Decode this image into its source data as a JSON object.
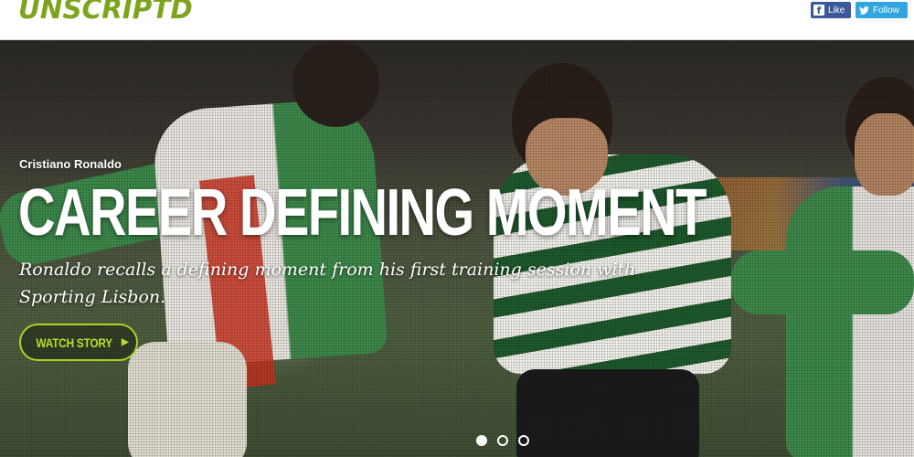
{
  "header": {
    "logo": "UNSCRIPTD",
    "social": {
      "facebook_label": "Like",
      "facebook_icon": "f",
      "twitter_label": "Follow",
      "twitter_icon": "🐦"
    }
  },
  "hero": {
    "subtitle": "Cristiano Ronaldo",
    "headline": "CAREER DEFINING MOMENT",
    "description": "Ronaldo recalls a defining moment from his first training session with Sporting Lisbon.",
    "cta_label": "WATCH STORY",
    "cta_icon": "▶"
  },
  "carousel": {
    "slide_count": 3,
    "active_index": 0
  },
  "colors": {
    "brand_green": "#7da51c",
    "cta_green": "#a6d323",
    "facebook": "#3b5998",
    "twitter": "#2fa6e0"
  }
}
